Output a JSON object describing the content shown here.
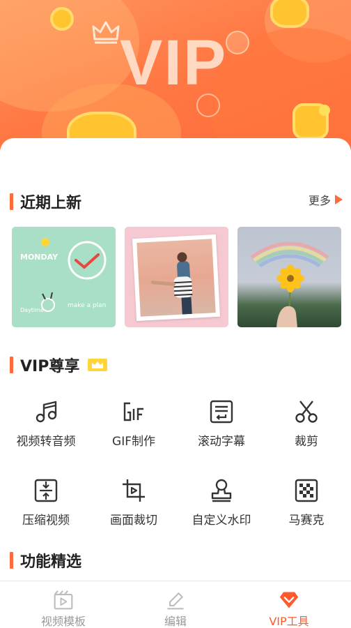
{
  "banner": {
    "title": "VIP"
  },
  "recent": {
    "title": "近期上新",
    "more_label": "更多",
    "items": [
      {
        "name": "monday-template",
        "text_monday": "MONDAY",
        "text_plan": "make a plan",
        "text_sign": "Daytime"
      },
      {
        "name": "couple-photo-template"
      },
      {
        "name": "rainbow-flower-template"
      }
    ]
  },
  "vip": {
    "title": "VIP尊享",
    "tools": [
      {
        "label": "视频转音频",
        "icon": "music-note-icon"
      },
      {
        "label": "GIF制作",
        "icon": "gif-icon"
      },
      {
        "label": "滚动字幕",
        "icon": "scroll-subtitle-icon"
      },
      {
        "label": "裁剪",
        "icon": "scissors-icon"
      },
      {
        "label": "压缩视频",
        "icon": "compress-icon"
      },
      {
        "label": "画面裁切",
        "icon": "crop-frame-icon"
      },
      {
        "label": "自定义水印",
        "icon": "stamp-icon"
      },
      {
        "label": "马赛克",
        "icon": "mosaic-icon"
      }
    ]
  },
  "features": {
    "title": "功能精选"
  },
  "bottom_nav": {
    "items": [
      {
        "label": "视频模板",
        "icon": "video-template-icon",
        "active": false
      },
      {
        "label": "编辑",
        "icon": "edit-pencil-icon",
        "active": false
      },
      {
        "label": "VIP工具",
        "icon": "vip-gem-icon",
        "active": true
      }
    ]
  },
  "colors": {
    "accent": "#ff6b3b",
    "active_tab": "#ff5a2e",
    "badge": "#ffd53a"
  }
}
